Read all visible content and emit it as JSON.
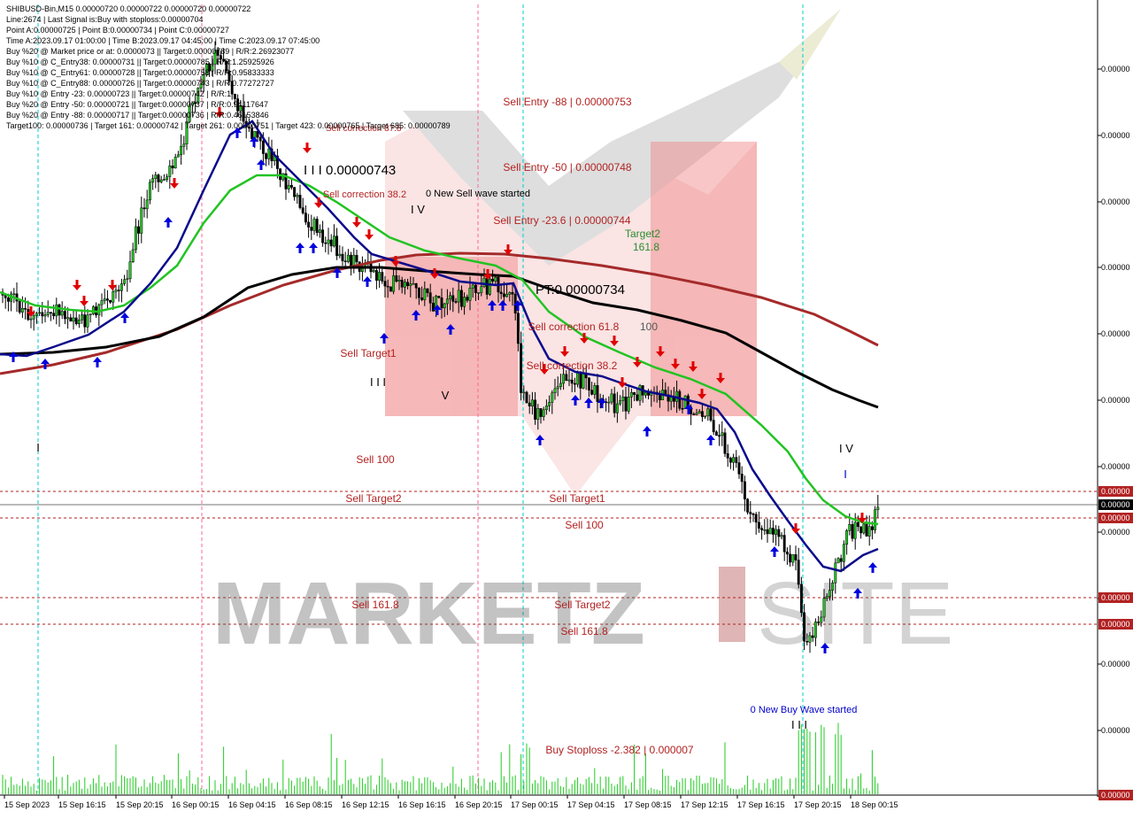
{
  "header": {
    "lines": [
      "SHIBUSD-Bin,M15  0.00000720 0.00000722 0.00000720 0.00000722",
      "Line:2674  | Last Signal is:Buy with stoploss:0.00000704",
      "Point A:0.00000725 | Point B:0.00000734 | Point C:0.00000727",
      "Time A:2023.09.17 01:00:00 | Time B:2023.09.17 04:45:00 | Time C:2023.09.17 07:45:00",
      "Buy %20 @ Market price or at: 0.0000073 || Target:0.00000789 | R/R:2.26923077",
      "Buy %10 @ C_Entry38: 0.00000731 || Target:0.00000785 | R/R:1.25925926",
      "Buy %10 @ C_Entry61: 0.00000728 || Target:0.00000758 | R/R:0.95833333",
      "Buy %10 @ C_Entry88: 0.00000726 || Target:0.00000743 | R/R:0.77272727",
      "Buy %10 @ Entry -23: 0.00000723 || Target:0.00000742 | R/R:1",
      "Buy %20 @ Entry -50: 0.00000721 || Target:0.00000737 | R/R:0.94117647",
      "Buy %20 @ Entry -88: 0.00000717 || Target:0.00000736 | R/R:0.46153846",
      "Target100: 0.00000736 | Target 161: 0.00000742 | Target 261: 0.00000751 | Target 423: 0.00000765 | Target 685: 0.00000789"
    ]
  },
  "watermark": {
    "text": "MARKETZ",
    "suffix": "SITE"
  },
  "price_axis": {
    "labels": [
      "0.00000",
      "0.00000",
      "0.00000",
      "0.00000",
      "0.00000",
      "0.00000",
      "0.00000",
      "0.00000",
      "0.00000",
      "0.00000",
      "0.00000",
      "0.00000",
      "0.00000"
    ],
    "highlight_labels": [
      "0.00000",
      "0.00000",
      "0.00000",
      "0.00000",
      "0.00000",
      "0.00000"
    ]
  },
  "time_axis": {
    "labels": [
      "15 Sep 2023",
      "15 Sep 16:15",
      "15 Sep 20:15",
      "16 Sep 00:15",
      "16 Sep 04:15",
      "16 Sep 08:15",
      "16 Sep 12:15",
      "16 Sep 16:15",
      "16 Sep 20:15",
      "17 Sep 00:15",
      "17 Sep 04:15",
      "17 Sep 08:15",
      "17 Sep 12:15",
      "17 Sep 16:15",
      "17 Sep 20:15",
      "18 Sep 00:15"
    ]
  },
  "annotations": {
    "sell_entry_88": "Sell Entry -88 | 0.00000753",
    "sell_entry_50": "Sell Entry -50 | 0.00000748",
    "sell_entry_23": "Sell Entry -23.6 | 0.00000744",
    "target2": "Target2",
    "target2_val": "161.8",
    "new_sell_wave": "0 New Sell wave started",
    "sell_corr_38": "Sell correction 38.2",
    "iv_mid": "I V",
    "iii_price": "I I I 0.00000743",
    "pt_price": "PT:0.00000734",
    "sell_corr_61": "Sell correction 61.8",
    "hundred": "100",
    "sell_corr_38_b": "Sell correction 38.2",
    "sell_target1_a": "Sell Target1",
    "iii_a": "I I I",
    "v_a": "V",
    "sell_100_a": "Sell 100",
    "sell_target2_a": "Sell Target2",
    "sell_target1_b": "Sell Target1",
    "sell_100_b": "Sell 100",
    "sell_161_a": "Sell 161.8",
    "sell_target2_b": "Sell Target2",
    "sell_161_b": "Sell 161.8",
    "iv_right": "I V",
    "i_right": "I",
    "i_left": "I",
    "new_buy_wave": "0 New Buy Wave started",
    "iii_bottom": "I I I",
    "buy_stoploss": "Buy Stoploss -2.382 | 0.000007",
    "sell_corr_top": "Sell correction 87.8"
  },
  "colors": {
    "background": "#ffffff",
    "ma_blue": "#0a0a8c",
    "ma_green": "#22c322",
    "ma_black": "#000000",
    "ma_red": "#a52a2a",
    "sell_text": "#b22222",
    "buy_text": "#0000cc",
    "zone_pink": "#f08080",
    "vline_cyan": "#00cccc",
    "vline_pink": "#ff6699",
    "hline_red": "#b22222",
    "volume_green": "#22cc22"
  },
  "chart_data": {
    "type": "line",
    "title": "SHIBUSD-Bin,M15",
    "xlabel": "",
    "ylabel": "",
    "x": [
      "15 Sep 2023",
      "15 Sep 16:15",
      "15 Sep 20:15",
      "16 Sep 00:15",
      "16 Sep 04:15",
      "16 Sep 08:15",
      "16 Sep 12:15",
      "16 Sep 16:15",
      "16 Sep 20:15",
      "17 Sep 00:15",
      "17 Sep 04:15",
      "17 Sep 08:15",
      "17 Sep 12:15",
      "17 Sep 16:15",
      "17 Sep 20:15",
      "18 Sep 00:15"
    ],
    "series": [
      {
        "values": [
          7.3,
          7.33,
          7.4,
          7.52,
          7.48,
          7.41,
          7.37,
          7.36,
          7.35,
          7.3,
          7.28,
          7.29,
          7.27,
          7.17,
          7.15,
          7.22
        ]
      },
      {
        "values": [
          7.32,
          7.31,
          7.34,
          7.45,
          7.46,
          7.43,
          7.39,
          7.37,
          7.36,
          7.33,
          7.29,
          7.28,
          7.28,
          7.22,
          7.18,
          7.21
        ]
      },
      {
        "values": [
          7.28,
          7.29,
          7.3,
          7.31,
          7.34,
          7.36,
          7.36,
          7.36,
          7.35,
          7.35,
          7.34,
          7.33,
          7.31,
          7.3,
          7.29,
          7.28
        ]
      },
      {
        "values": [
          7.25,
          7.26,
          7.27,
          7.29,
          7.31,
          7.34,
          7.36,
          7.36,
          7.36,
          7.36,
          7.36,
          7.35,
          7.34,
          7.33,
          7.32,
          7.31
        ]
      }
    ],
    "ylim": [
      7.0,
      7.62
    ],
    "grid": false
  }
}
